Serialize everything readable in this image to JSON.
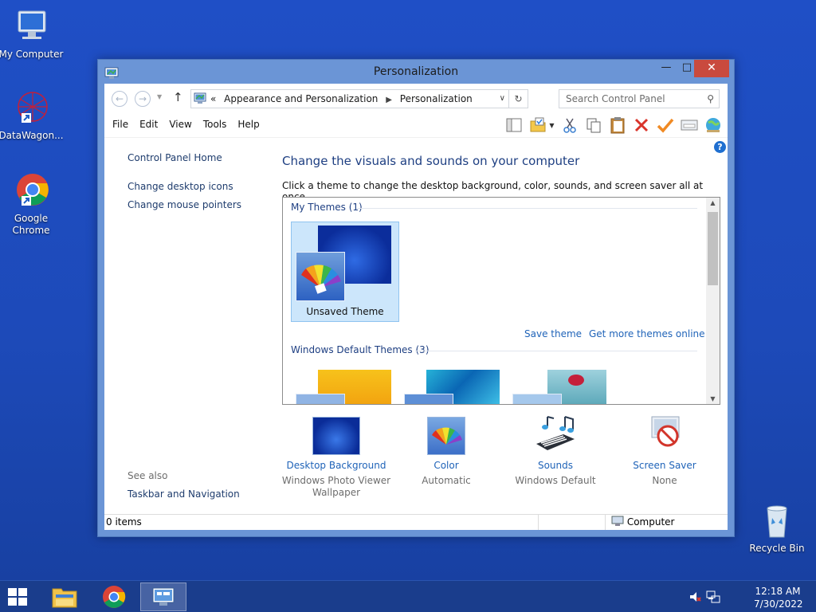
{
  "desktop": {
    "icons": [
      {
        "label": "My Computer"
      },
      {
        "label": "DataWagon..."
      },
      {
        "label": "Google Chrome"
      },
      {
        "label": "Recycle Bin"
      }
    ]
  },
  "window": {
    "title": "Personalization",
    "address": {
      "overflow": "«",
      "crumbs": [
        "Appearance and Personalization",
        "Personalization"
      ]
    },
    "search_placeholder": "Search Control Panel",
    "menu": [
      "File",
      "Edit",
      "View",
      "Tools",
      "Help"
    ],
    "left_pane": {
      "home": "Control Panel Home",
      "links": [
        "Change desktop icons",
        "Change mouse pointers"
      ],
      "see_also_label": "See also",
      "see_also_links": [
        "Taskbar and Navigation"
      ]
    },
    "main": {
      "heading": "Change the visuals and sounds on your computer",
      "subtitle": "Click a theme to change the desktop background, color, sounds, and screen saver all at once.",
      "my_themes_label": "My Themes (1)",
      "unsaved_theme": "Unsaved Theme",
      "save_theme": "Save theme",
      "get_more": "Get more themes online",
      "default_themes_label": "Windows Default Themes (3)"
    },
    "settings": [
      {
        "label": "Desktop Background",
        "value": "Windows Photo Viewer Wallpaper"
      },
      {
        "label": "Color",
        "value": "Automatic"
      },
      {
        "label": "Sounds",
        "value": "Windows Default"
      },
      {
        "label": "Screen Saver",
        "value": "None"
      }
    ],
    "status": {
      "items": "0 items",
      "zone": "Computer"
    }
  },
  "taskbar": {
    "time": "12:18 AM",
    "date": "7/30/2022"
  },
  "colors": {
    "desktop": "#1d4ab9",
    "link": "#1f63b8",
    "heading": "#1e3f82",
    "close": "#c94a3e"
  }
}
